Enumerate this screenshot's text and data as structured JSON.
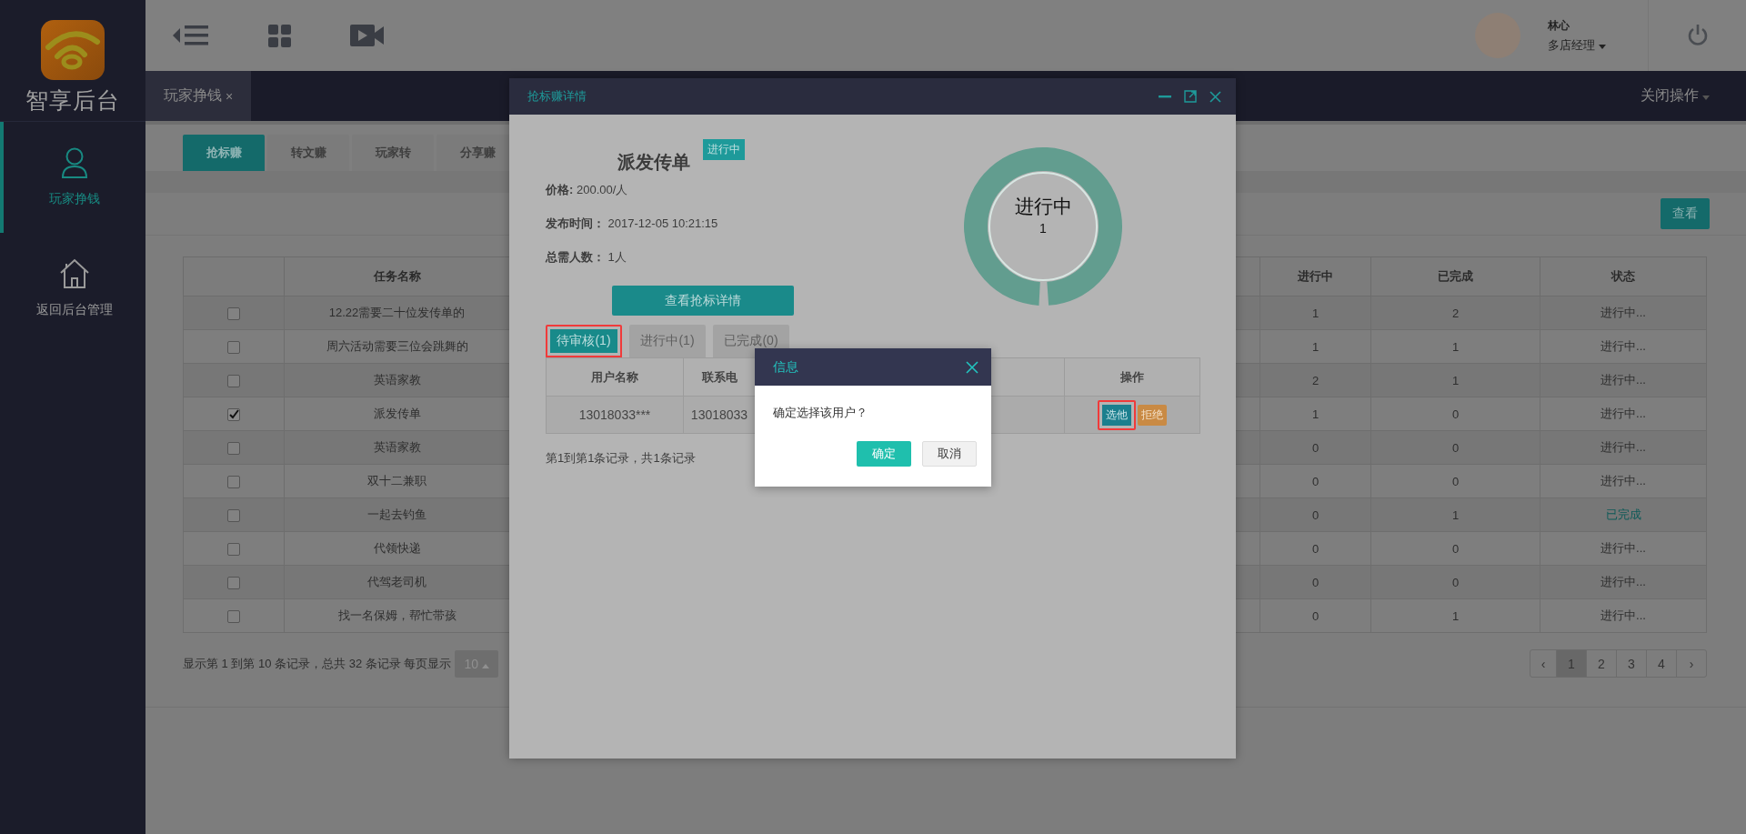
{
  "sidebar": {
    "logo_text": "智享后台",
    "items": [
      {
        "label": "玩家挣钱",
        "kind": "user",
        "selected": true
      },
      {
        "label": "返回后台管理",
        "kind": "home",
        "selected": false
      }
    ]
  },
  "header": {
    "user": {
      "name": "林心",
      "role": "多店经理"
    }
  },
  "page_tabs": [
    {
      "label": "玩家挣钱",
      "close": "×",
      "selected": true
    }
  ],
  "close_actions": "关闭操作",
  "sub_tabs": [
    {
      "label": "抢标赚",
      "selected": true
    },
    {
      "label": "转文赚",
      "selected": false
    },
    {
      "label": "玩家转",
      "selected": false
    },
    {
      "label": "分享赚",
      "selected": false
    }
  ],
  "view_button": "查看",
  "table": {
    "columns": [
      "任务名称",
      "进行中",
      "已完成",
      "状态"
    ],
    "rows": [
      {
        "checked": false,
        "task_name": "12.22需要二十位发传单的",
        "in_progress": "1",
        "completed": "2",
        "status": "进行中...",
        "kind": "progress"
      },
      {
        "checked": false,
        "task_name": "周六活动需要三位会跳舞的",
        "in_progress": "1",
        "completed": "1",
        "status": "进行中...",
        "kind": "progress"
      },
      {
        "checked": false,
        "task_name": "英语家教",
        "in_progress": "2",
        "completed": "1",
        "status": "进行中...",
        "kind": "progress"
      },
      {
        "checked": true,
        "task_name": "派发传单",
        "in_progress": "1",
        "completed": "0",
        "status": "进行中...",
        "kind": "progress"
      },
      {
        "checked": false,
        "task_name": "英语家教",
        "in_progress": "0",
        "completed": "0",
        "status": "进行中...",
        "kind": "progress"
      },
      {
        "checked": false,
        "task_name": "双十二兼职",
        "in_progress": "0",
        "completed": "0",
        "status": "进行中...",
        "kind": "progress"
      },
      {
        "checked": false,
        "task_name": "一起去钓鱼",
        "in_progress": "0",
        "completed": "1",
        "status": "已完成",
        "kind": "done"
      },
      {
        "checked": false,
        "task_name": "代领快递",
        "in_progress": "0",
        "completed": "0",
        "status": "进行中...",
        "kind": "progress"
      },
      {
        "checked": false,
        "task_name": "代驾老司机",
        "in_progress": "0",
        "completed": "0",
        "status": "进行中...",
        "kind": "progress"
      },
      {
        "checked": false,
        "task_name": "找一名保姆，帮忙带孩",
        "in_progress": "0",
        "completed": "1",
        "status": "进行中...",
        "kind": "progress"
      }
    ]
  },
  "pagination": {
    "summary": "显示第 1 到第 10 条记录，总共 32 条记录 每页显示",
    "page_size": "10",
    "prev": "‹",
    "pages": [
      {
        "label": "1",
        "selected": true
      },
      {
        "label": "2",
        "selected": false
      },
      {
        "label": "3",
        "selected": false
      },
      {
        "label": "4",
        "selected": false
      }
    ],
    "next": "›"
  },
  "detail_modal": {
    "title": "抢标赚详情",
    "task_title": "派发传单",
    "status_badge": "进行中",
    "fields": [
      {
        "label": "价格:",
        "value": "200.00/人"
      },
      {
        "label": "发布时间：",
        "value": "2017-12-05 10:21:15"
      },
      {
        "label": "总需人数：",
        "value": "1人"
      }
    ],
    "detail_button": "查看抢标详情",
    "gauge": {
      "label": "进行中",
      "count": "1"
    },
    "tabs": [
      {
        "label": "待审核(1)",
        "selected": true,
        "highlighted": true
      },
      {
        "label": "进行中(1)",
        "selected": false,
        "highlighted": false
      },
      {
        "label": "已完成(0)",
        "selected": false,
        "highlighted": false
      }
    ],
    "table": {
      "columns": [
        "用户名称",
        "联系电",
        "操作"
      ],
      "rows": [
        {
          "user": "13018033***",
          "phone": "13018033",
          "actions": [
            {
              "label": "选他",
              "kind": "select",
              "highlighted": true
            },
            {
              "label": "拒绝",
              "kind": "reject",
              "highlighted": false
            }
          ]
        }
      ]
    },
    "summary": "第1到第1条记录，共1条记录"
  },
  "confirm_dialog": {
    "title": "信息",
    "message": "确定选择该用户？",
    "buttons": [
      {
        "label": "确定",
        "kind": "primary"
      },
      {
        "label": "取消",
        "kind": "secondary"
      }
    ]
  }
}
